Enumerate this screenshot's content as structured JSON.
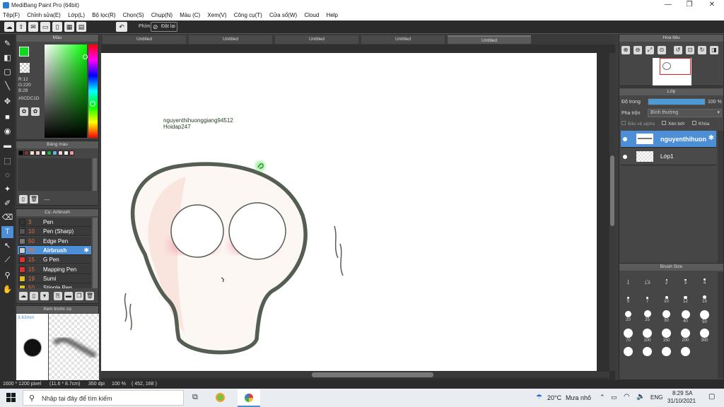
{
  "window": {
    "title": "MediBang Paint Pro (64bit)"
  },
  "menu": [
    "Tệp(F)",
    "Chỉnh sửa(E)",
    "Lớp(L)",
    "Bộ lọc(R)",
    "Chọn(S)",
    "Chụp(N)",
    "Màu (C)",
    "Xem(V)",
    "Công cụ(T)",
    "Cửa sổ(W)",
    "Cloud",
    "Help"
  ],
  "toolbar": {
    "stabilizer_label": "Phím",
    "reset_label": "Đặt lại"
  },
  "tabs": [
    "Untitled",
    "Untitled",
    "Untitled",
    "Untitled",
    "Untitled"
  ],
  "color_panel": {
    "title": "Màu",
    "r": "R:12",
    "g": "G:220",
    "b": "B:29",
    "hex": "#0CDC1D",
    "fg_color": "#0cdc1d",
    "bg_color": "#000000"
  },
  "palette": {
    "title": "Bảng màu",
    "more_label": "---",
    "swatches": [
      "#000000",
      "#7a3a2a",
      "#f4e0d0",
      "#f2c6c6",
      "#f6f6f6",
      "#2aa84a",
      "#6ab0e0",
      "#f5d5d5",
      "#f0f0f0",
      "#e89aa0"
    ]
  },
  "brush_panel": {
    "title": "Cọ: Airbrush",
    "brushes": [
      {
        "size": "3",
        "name": "Pen",
        "color": "#333333"
      },
      {
        "size": "10",
        "name": "Pen (Sharp)",
        "color": "#555555"
      },
      {
        "size": "50",
        "name": "Edge Pen",
        "color": "#777777"
      },
      {
        "size": "50",
        "name": "Airbrush",
        "color": "#cccccc"
      },
      {
        "size": "15",
        "name": "G Pen",
        "color": "#e03030"
      },
      {
        "size": "15",
        "name": "Mapping Pen",
        "color": "#e03030"
      },
      {
        "size": "19",
        "name": "Sumi",
        "color": "#e0c020"
      },
      {
        "size": "50",
        "name": "Stipple Pen",
        "color": "#e0c020"
      }
    ]
  },
  "preview_panel": {
    "title": "Xem trước cọ",
    "size_label": "3.63mm"
  },
  "canvas": {
    "text_line1": "nguyenthihuonggiang94512",
    "text_line2": "Hoidap247"
  },
  "navigator": {
    "title": "Hoa tiêu"
  },
  "layers": {
    "title": "Lớp",
    "opacity_label": "Độ trong",
    "opacity_value": "100 %",
    "opacity": 1.0,
    "blend_label": "Pha trộn",
    "blend_value": "Bình thường",
    "protect_alpha": "Bảo vệ alpha",
    "clipping": "Xén bớt",
    "lock": "Khóa",
    "items": [
      {
        "name": "nguyenthihuon",
        "active": true
      },
      {
        "name": "Lớp1",
        "active": false
      }
    ]
  },
  "brush_size": {
    "title": "Brush Size",
    "sizes": [
      "1",
      "1.5",
      "2",
      "3",
      "4",
      "5",
      "7",
      "10",
      "12",
      "15",
      "20",
      "25",
      "30",
      "40",
      "50",
      "70",
      "100",
      "150",
      "200",
      "300",
      "",
      "",
      "",
      ""
    ]
  },
  "status": {
    "dimensions": "1600 * 1200 pixel",
    "physical": "(11.6 * 8.7cm)",
    "dpi": "350 dpi",
    "zoom": "100 %",
    "cursor": "( 452, 168 )"
  },
  "taskbar": {
    "search_placeholder": "Nhập tại đây để tìm kiếm",
    "weather_temp": "20°C",
    "weather_text": "Mưa nhỏ",
    "lang": "ENG",
    "time": "8:29 SA",
    "date": "31/10/2021"
  }
}
